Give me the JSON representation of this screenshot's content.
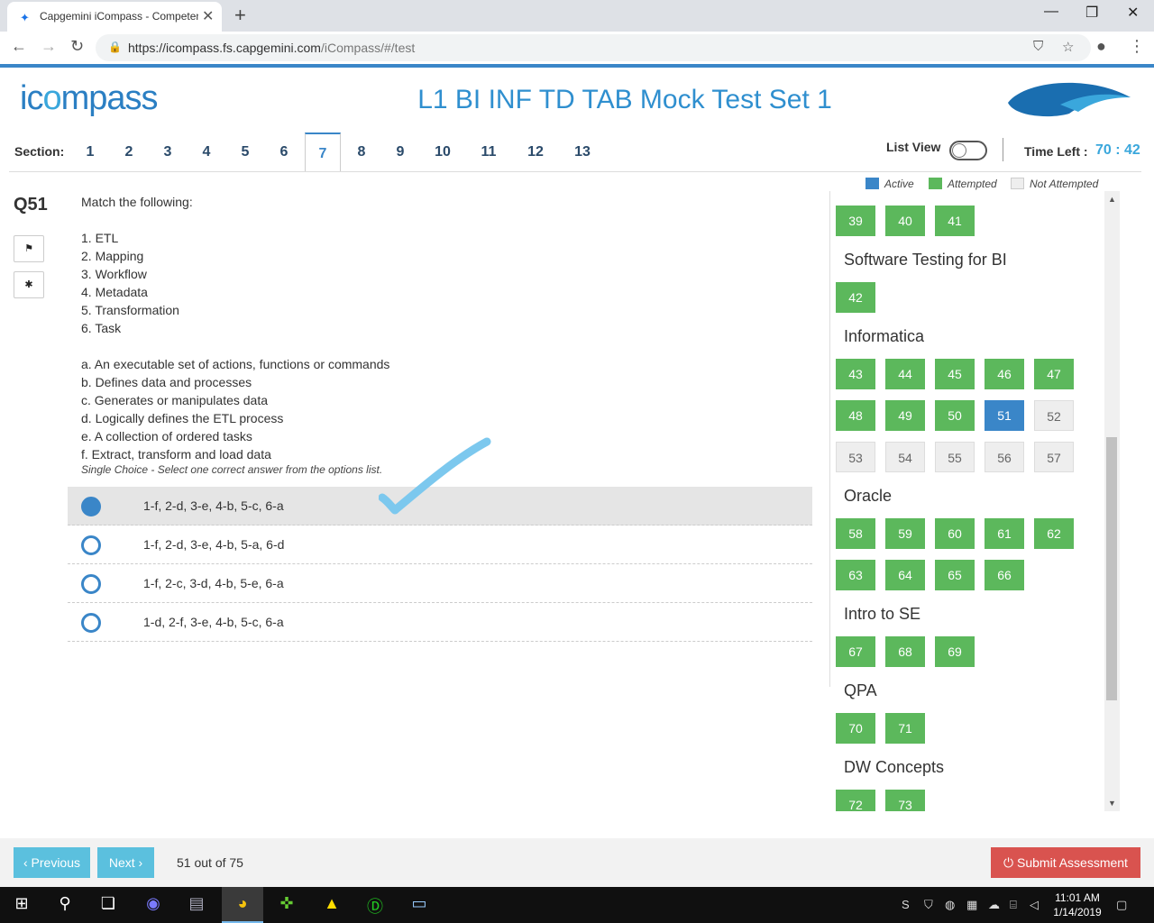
{
  "browser": {
    "tab_title": "Capgemini iCompass - Competen",
    "url_host": "https://icompass.fs.capgemini.com",
    "url_path": "/iCompass/#/test",
    "favicon": "compass-star-icon"
  },
  "header": {
    "logo_text_start": "ic",
    "logo_text_mid": "o",
    "logo_text_end": "mpass",
    "exam_title": "L1 BI INF TD TAB Mock Test Set 1"
  },
  "sections": {
    "label": "Section:",
    "tabs": [
      "1",
      "2",
      "3",
      "4",
      "5",
      "6",
      "7",
      "8",
      "9",
      "10",
      "11",
      "12",
      "13"
    ],
    "active": "7"
  },
  "list_view": {
    "label": "List View",
    "enabled": false
  },
  "timer": {
    "label": "Time Left :",
    "value": "70 : 42"
  },
  "question": {
    "number": "Q51",
    "prompt": "Match the following:",
    "left_items": [
      "1. ETL",
      "2. Mapping",
      "3. Workflow",
      "4. Metadata",
      "5. Transformation",
      "6. Task"
    ],
    "right_items": [
      "a. An executable set of actions, functions or commands",
      "b. Defines data and processes",
      "c. Generates or manipulates data",
      "d. Logically defines the ETL process",
      "e. A collection of ordered tasks",
      "f. Extract, transform and load data"
    ],
    "hint": "Single Choice - Select one correct answer from the options list.",
    "options": [
      {
        "label": "1-f, 2-d, 3-e, 4-b, 5-c, 6-a",
        "selected": true
      },
      {
        "label": "1-f, 2-d, 3-e, 4-b, 5-a, 6-d",
        "selected": false
      },
      {
        "label": "1-f, 2-c, 3-d, 4-b, 5-e, 6-a",
        "selected": false
      },
      {
        "label": "1-d, 2-f, 3-e, 4-b, 5-c, 6-a",
        "selected": false
      }
    ]
  },
  "legend": {
    "active": "Active",
    "attempted": "Attempted",
    "not_attempted": "Not Attempted",
    "colors": {
      "active": "#3a86c8",
      "attempted": "#5cb85c",
      "not_attempted": "#eeeeee"
    }
  },
  "palette": {
    "top_row": [
      "39",
      "40",
      "41"
    ],
    "groups": [
      {
        "title": "Software Testing for BI",
        "rows": [
          [
            "42"
          ]
        ]
      },
      {
        "title": "Informatica",
        "rows": [
          [
            "43",
            "44",
            "45",
            "46",
            "47"
          ],
          [
            "48",
            "49",
            "50",
            "51",
            "52"
          ],
          [
            "53",
            "54",
            "55",
            "56",
            "57"
          ]
        ]
      },
      {
        "title": "Oracle",
        "rows": [
          [
            "58",
            "59",
            "60",
            "61",
            "62"
          ],
          [
            "63",
            "64",
            "65",
            "66"
          ]
        ]
      },
      {
        "title": "Intro to SE",
        "rows": [
          [
            "67",
            "68",
            "69"
          ]
        ]
      },
      {
        "title": "QPA",
        "rows": [
          [
            "70",
            "71"
          ]
        ]
      },
      {
        "title": "DW Concepts",
        "rows": [
          [
            "72",
            "73"
          ]
        ]
      }
    ],
    "active": "51",
    "not_attempted": [
      "52",
      "53",
      "54",
      "55",
      "56",
      "57"
    ]
  },
  "footer": {
    "previous": "‹ Previous",
    "next": "Next ›",
    "progress": "51 out of 75",
    "submit": "⏻ Submit Assessment"
  },
  "taskbar": {
    "time": "11:01 AM",
    "date": "1/14/2019"
  }
}
